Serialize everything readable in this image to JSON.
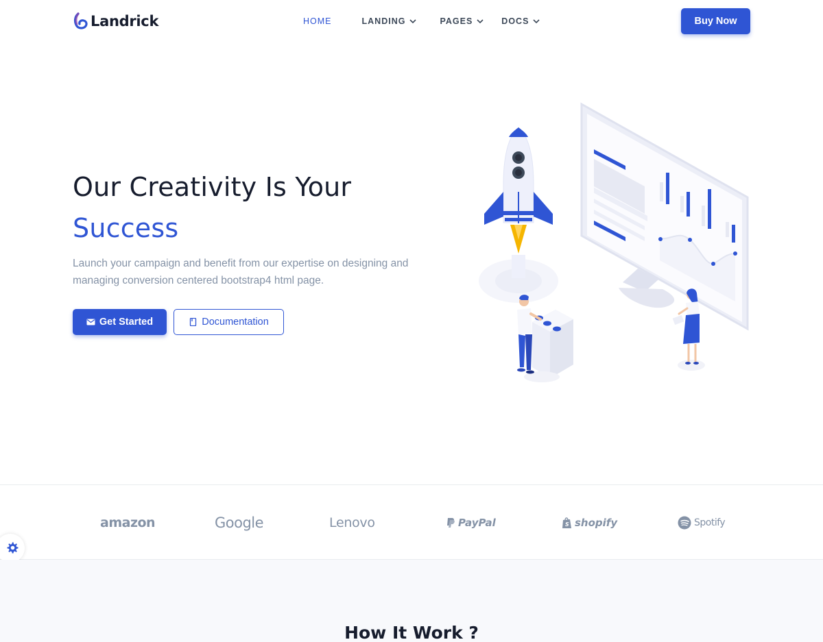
{
  "header": {
    "brand": "Landrick",
    "nav": [
      {
        "label": "HOME",
        "active": true,
        "dropdown": false
      },
      {
        "label": "LANDING",
        "active": false,
        "dropdown": true
      },
      {
        "label": "PAGES",
        "active": false,
        "dropdown": true
      },
      {
        "label": "DOCS",
        "active": false,
        "dropdown": true
      }
    ],
    "buy_label": "Buy Now"
  },
  "hero": {
    "title_line1": "Our Creativity Is Your",
    "title_accent": "Success",
    "description": "Launch your campaign and benefit from our expertise on designing and managing conversion centered bootstrap4 html page.",
    "primary_button": {
      "label": "Get Started",
      "icon": "mail-icon"
    },
    "secondary_button": {
      "label": "Documentation",
      "icon": "book-icon"
    }
  },
  "partners": [
    "amazon",
    "Google",
    "Lenovo",
    "PayPal",
    "shopify",
    "Spotify"
  ],
  "section_title": "How It Work ?",
  "colors": {
    "primary": "#2f55d4",
    "dark": "#161c2d",
    "muted": "#8492a6",
    "logo_gray": "#8492a6",
    "rocket_flame": "#f5b500"
  }
}
